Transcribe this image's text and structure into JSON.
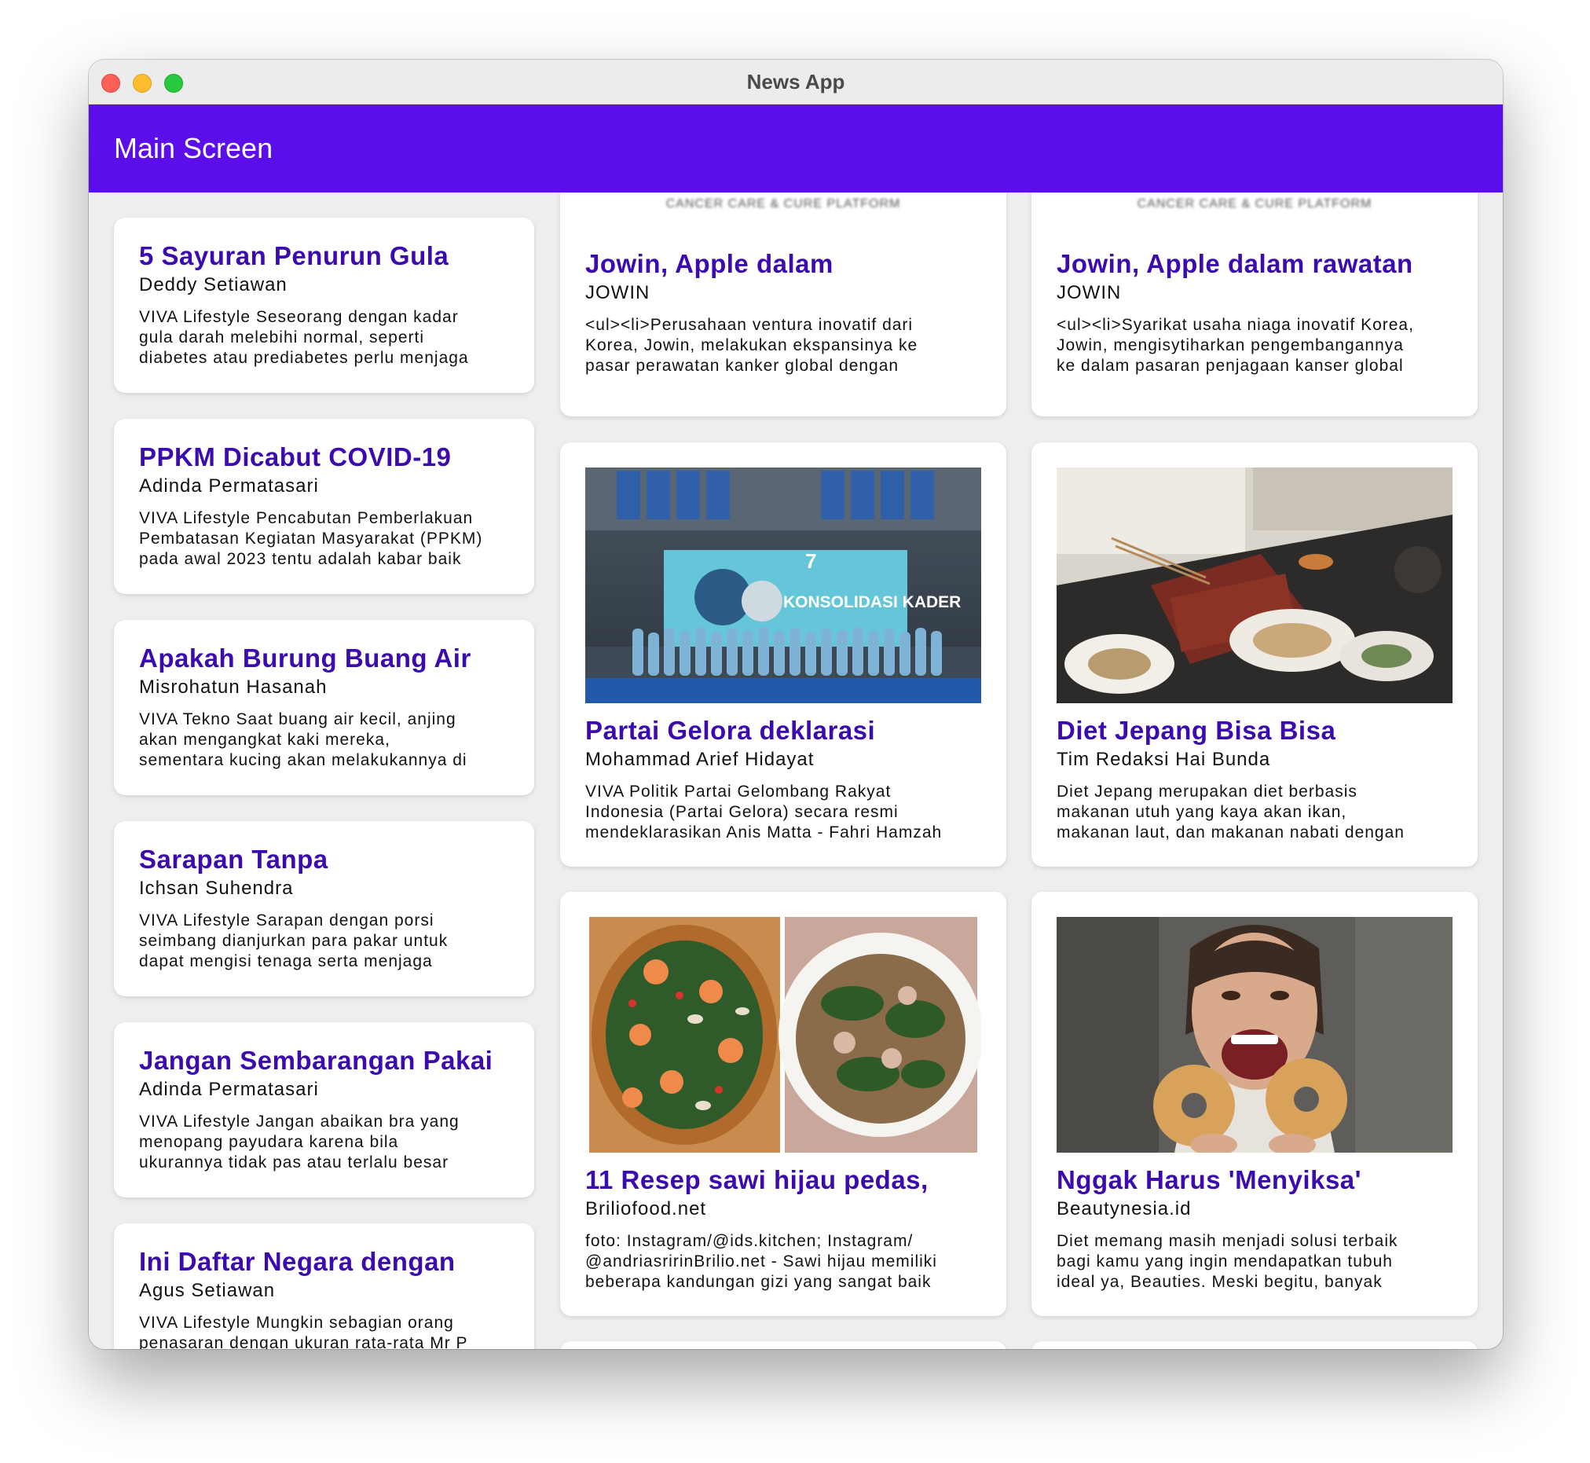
{
  "window": {
    "title": "News App"
  },
  "appbar": {
    "title": "Main Screen"
  },
  "left_cards": [
    {
      "title": "5 Sayuran Penurun Gula",
      "author": "Deddy Setiawan",
      "desc": "VIVA Lifestyle  Seseorang dengan kadar\ngula darah melebihi normal, seperti\ndiabetes atau prediabetes perlu menjaga"
    },
    {
      "title": "PPKM Dicabut COVID-19",
      "author": "Adinda Permatasari",
      "desc": "VIVA Lifestyle  Pencabutan Pemberlakuan\nPembatasan Kegiatan Masyarakat (PPKM)\npada awal 2023 tentu adalah kabar baik"
    },
    {
      "title": "Apakah Burung Buang Air",
      "author": "Misrohatun Hasanah",
      "desc": "VIVA Tekno  Saat buang air kecil, anjing\nakan mengangkat kaki mereka,\nsementara kucing akan melakukannya di"
    },
    {
      "title": "Sarapan Tanpa",
      "author": "Ichsan Suhendra",
      "desc": "VIVA Lifestyle  Sarapan dengan porsi\nseimbang dianjurkan para pakar untuk\ndapat mengisi tenaga serta menjaga"
    },
    {
      "title": "Jangan Sembarangan Pakai",
      "author": "Adinda Permatasari",
      "desc": "VIVA Lifestyle  Jangan abaikan bra yang\nmenopang payudara karena bila\nukurannya tidak pas atau terlalu besar"
    },
    {
      "title": "Ini Daftar Negara dengan",
      "author": "Agus Setiawan",
      "desc": "VIVA Lifestyle  Mungkin sebagian orang\npenasaran dengan ukuran rata-rata Mr P"
    }
  ],
  "grid_cards": [
    {
      "title": "Jowin, Apple dalam",
      "author": "JOWIN",
      "desc": "<ul><li>Perusahaan ventura inovatif dari\nKorea, Jowin, melakukan ekspansinya ke\npasar perawatan kanker global dengan",
      "image": "cancer-care-logo",
      "logo_text": "CANCER CARE & CURE PLATFORM"
    },
    {
      "title": "Jowin, Apple dalam rawatan",
      "author": "JOWIN",
      "desc": "<ul><li>Syarikat usaha niaga inovatif Korea,\nJowin, mengisytiharkan pengembangannya\nke dalam pasaran penjagaan kanser global",
      "image": "cancer-care-logo",
      "logo_text": "CANCER CARE & CURE PLATFORM"
    },
    {
      "title": "Partai Gelora deklarasi",
      "author": "Mohammad Arief Hidayat",
      "desc": "VIVA Politik  Partai Gelombang Rakyat\nIndonesia (Partai Gelora) secara resmi\nmendeklarasikan Anis Matta - Fahri Hamzah",
      "image": "political-rally-photo",
      "banner_text": "KONSOLIDASI KADER",
      "badge_text": "7"
    },
    {
      "title": "Diet Jepang Bisa Bisa",
      "author": "Tim Redaksi Hai Bunda",
      "desc": "Diet Jepang merupakan diet berbasis\nmakanan utuh yang kaya akan ikan,\nmakanan laut, dan makanan nabati dengan",
      "image": "japanese-meal-photo"
    },
    {
      "title": "11 Resep sawi hijau pedas,",
      "author": "Briliofood.net",
      "desc": "foto: Instagram/@ids.kitchen; Instagram/\n@andriasririnBrilio.net - Sawi hijau memiliki\nbeberapa kandungan gizi yang sangat baik",
      "image": "stir-fry-greens-photo"
    },
    {
      "title": "Nggak Harus 'Menyiksa'",
      "author": "Beautynesia.id",
      "desc": "Diet memang masih menjadi solusi terbaik\nbagi kamu yang ingin mendapatkan tubuh\nideal ya, Beauties. Meski begitu, banyak",
      "image": "woman-donuts-photo"
    }
  ],
  "colors": {
    "accent": "#5b0ee9",
    "title_text": "#3b0bb0",
    "background": "#efeeef"
  }
}
